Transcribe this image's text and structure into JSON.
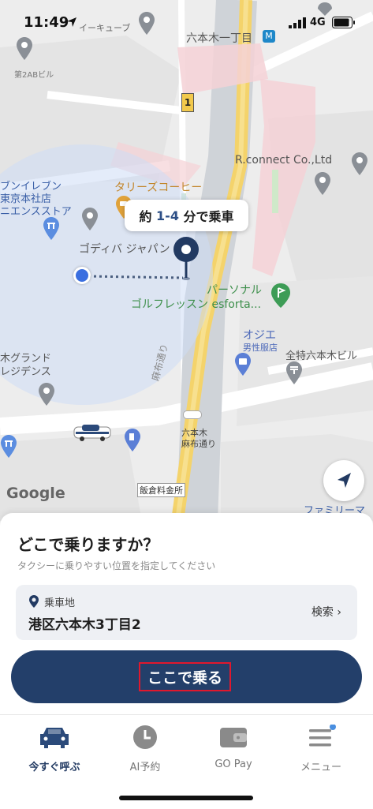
{
  "status_bar": {
    "time": "11:49",
    "network": "4G"
  },
  "map": {
    "labels": {
      "station": "六本木一丁目",
      "kyube": "イーキューブ",
      "bldg_2ab": "第2ABビル",
      "rconnect": "R.connect Co.,Ltd",
      "tullys": "タリーズコーヒー",
      "seven1": "ブンイレブン",
      "seven2": "東京本社店",
      "seven3": "ニエンスストア",
      "godiva": "ゴディバ ジャパン 本社",
      "golf1": "パーソナル",
      "golf2": "ゴルフレッスン esforta...",
      "ojie1": "オジエ",
      "ojie2": "男性服店",
      "zentoku": "全特六本木ビル",
      "grand1": "木グランド",
      "grand2": "レジデンス",
      "azabu_road": "麻布通り",
      "azabu_stop1": "六本木",
      "azabu_stop2": "麻布通り",
      "iikura": "飯倉料金所",
      "family": "ファミリーマ",
      "route_marker": "1",
      "google": "Google"
    },
    "eta": {
      "prefix": "約 ",
      "range": "1-4",
      "suffix": " 分で乗車"
    }
  },
  "sheet": {
    "title": "どこで乗りますか？",
    "subtitle": "タクシーに乗りやすい位置を指定してください",
    "pickup_label": "乗車地",
    "pickup_address": "港区六本木3丁目2",
    "search_label": "検索 ›",
    "confirm_label": "ここで乗る"
  },
  "tabs": [
    {
      "label": "今すぐ呼ぶ",
      "icon": "taxi-icon",
      "active": true
    },
    {
      "label": "AI予約",
      "icon": "clock-icon",
      "active": false
    },
    {
      "label": "GO Pay",
      "icon": "wallet-icon",
      "active": false
    },
    {
      "label": "メニュー",
      "icon": "menu-icon",
      "active": false
    }
  ],
  "colors": {
    "primary": "#233f6a",
    "highlight": "#e0182d",
    "pin": "#223a62",
    "location_blue": "#3b6fe0"
  }
}
